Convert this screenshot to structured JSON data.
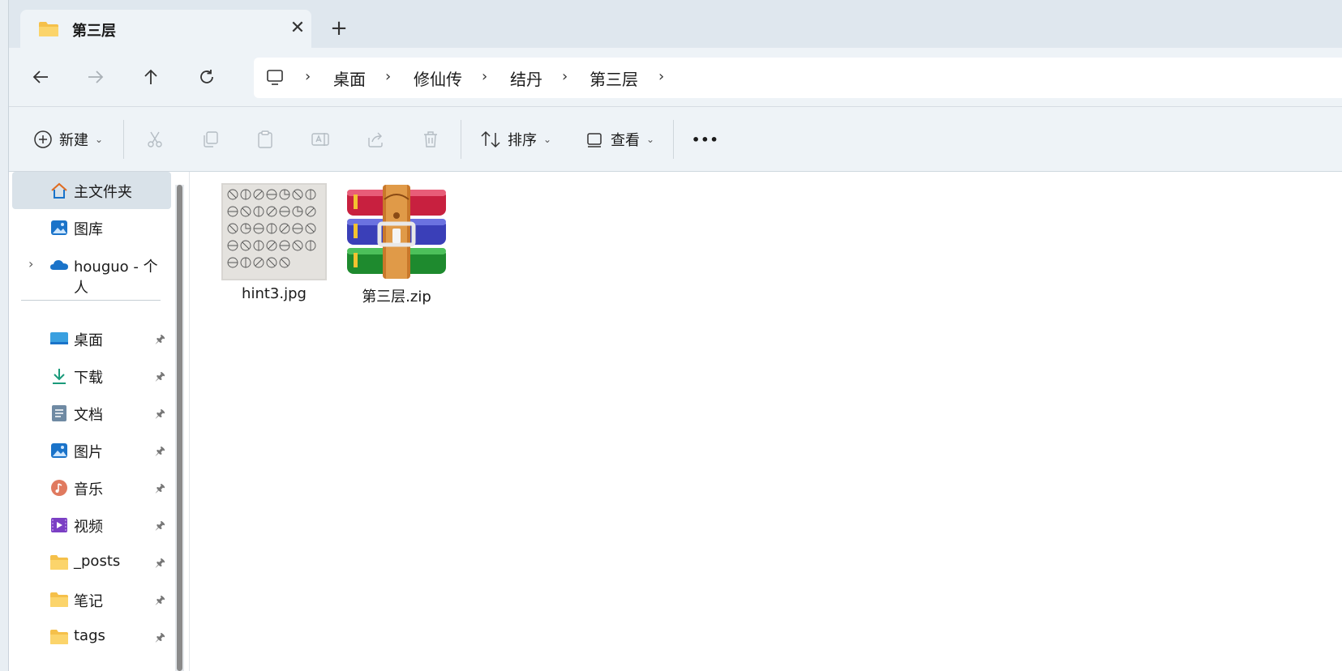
{
  "tab": {
    "title": "第三层",
    "close": "✕",
    "new_tab": "+"
  },
  "nav": {
    "back": "←",
    "forward": "→",
    "up": "↑",
    "refresh": "↻",
    "breadcrumbs": [
      "桌面",
      "修仙传",
      "结丹",
      "第三层"
    ],
    "separator": "›"
  },
  "toolbar": {
    "new_label": "新建",
    "sort_label": "排序",
    "view_label": "查看",
    "more_label": "•••",
    "caret": "⌄"
  },
  "sidebar": {
    "top_items": [
      {
        "label": "主文件夹",
        "icon": "home-icon"
      },
      {
        "label": "图库",
        "icon": "gallery-icon"
      },
      {
        "label": "houguo - 个人",
        "icon": "onedrive-cloud-icon"
      }
    ],
    "pinned_items": [
      {
        "label": "桌面",
        "icon": "desktop-icon"
      },
      {
        "label": "下载",
        "icon": "download-icon"
      },
      {
        "label": "文档",
        "icon": "document-icon"
      },
      {
        "label": "图片",
        "icon": "pictures-icon"
      },
      {
        "label": "音乐",
        "icon": "music-icon"
      },
      {
        "label": "视频",
        "icon": "video-icon"
      },
      {
        "label": "_posts",
        "icon": "folder-icon"
      },
      {
        "label": "笔记",
        "icon": "folder-icon"
      },
      {
        "label": "tags",
        "icon": "folder-icon"
      }
    ],
    "pin_glyph": "📌",
    "expand_glyph": "›"
  },
  "files": [
    {
      "name": "hint3.jpg",
      "type": "image"
    },
    {
      "name": "第三层.zip",
      "type": "archive"
    }
  ],
  "colors": {
    "folder": "#f5c04a",
    "accent": "#1a73c9"
  }
}
